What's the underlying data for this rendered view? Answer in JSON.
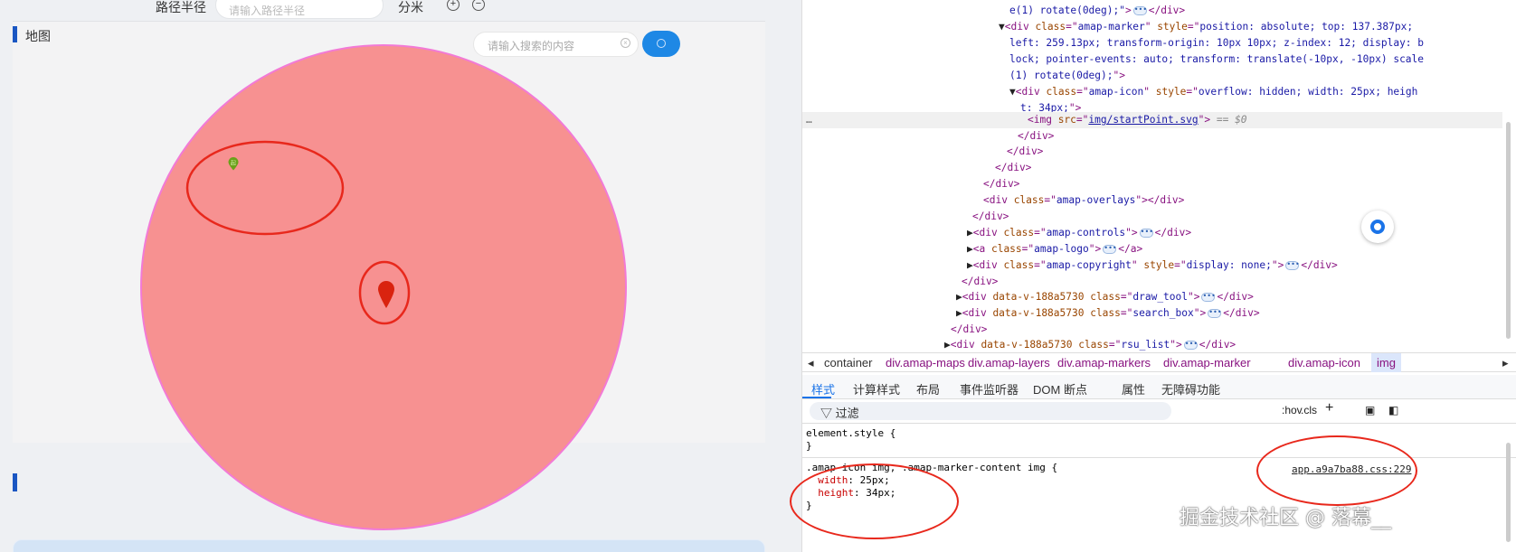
{
  "left": {
    "radius_label": "路径半径",
    "radius_placeholder": "请输入路径半径",
    "unit": "分米",
    "zoom_in": "+",
    "zoom_out": "−",
    "panel_title": "地图",
    "search_placeholder": "请输入搜索的内容",
    "start_marker_label": "起",
    "colors": {
      "circle_fill": "#f79191",
      "circle_stroke": "#f27ad6",
      "annotation": "#e8281c",
      "accent": "#1e88e5"
    }
  },
  "devtools": {
    "dom_lines": [
      [
        [
          "v",
          "e(1) rotate(0deg);\""
        ],
        [
          "t",
          ">"
        ],
        [
          "d",
          ""
        ],
        [
          "t",
          "</div>"
        ]
      ],
      [
        [
          "p",
          "▼"
        ],
        [
          "t",
          "<div "
        ],
        [
          "a",
          "class"
        ],
        [
          "t",
          "=\""
        ],
        [
          "v",
          "amap-marker"
        ],
        [
          "t",
          "\" "
        ],
        [
          "a",
          "style"
        ],
        [
          "t",
          "=\""
        ],
        [
          "v",
          "position: absolute; top: 137.387px;"
        ]
      ],
      [
        [
          "v",
          "left: 259.13px; transform-origin: 10px 10px; z-index: 12; display: b"
        ]
      ],
      [
        [
          "v",
          "lock; pointer-events: auto; transform: translate(-10px, -10px) scale"
        ]
      ],
      [
        [
          "v",
          "(1) rotate(0deg);"
        ],
        [
          "t",
          "\">"
        ]
      ],
      [
        [
          "p",
          "▼"
        ],
        [
          "t",
          "<div "
        ],
        [
          "a",
          "class"
        ],
        [
          "t",
          "=\""
        ],
        [
          "v",
          "amap-icon"
        ],
        [
          "t",
          "\" "
        ],
        [
          "a",
          "style"
        ],
        [
          "t",
          "=\""
        ],
        [
          "v",
          "overflow: hidden; width: 25px; heigh"
        ]
      ],
      [
        [
          "v",
          "t: 34px;"
        ],
        [
          "t",
          "\">"
        ]
      ],
      [
        [
          "t",
          "<img "
        ],
        [
          "a",
          "src"
        ],
        [
          "t",
          "=\""
        ],
        [
          "u",
          "img/startPoint.svg"
        ],
        [
          "t",
          "\">"
        ],
        [
          "g",
          " == $0"
        ]
      ],
      [
        [
          "t",
          "</div>"
        ]
      ],
      [
        [
          "t",
          "</div>"
        ]
      ],
      [
        [
          "t",
          "</div>"
        ]
      ],
      [
        [
          "t",
          "</div>"
        ]
      ],
      [
        [
          "t",
          "<div "
        ],
        [
          "a",
          "class"
        ],
        [
          "t",
          "=\""
        ],
        [
          "v",
          "amap-overlays"
        ],
        [
          "t",
          "\"></div>"
        ]
      ],
      [
        [
          "t",
          "</div>"
        ]
      ],
      [
        [
          "p",
          "▶"
        ],
        [
          "t",
          "<div "
        ],
        [
          "a",
          "class"
        ],
        [
          "t",
          "=\""
        ],
        [
          "v",
          "amap-controls"
        ],
        [
          "t",
          "\">"
        ],
        [
          "d",
          ""
        ],
        [
          "t",
          "</div>"
        ]
      ],
      [
        [
          "p",
          "▶"
        ],
        [
          "t",
          "<a "
        ],
        [
          "a",
          "class"
        ],
        [
          "t",
          "=\""
        ],
        [
          "v",
          "amap-logo"
        ],
        [
          "t",
          "\">"
        ],
        [
          "d",
          ""
        ],
        [
          "t",
          "</a>"
        ]
      ],
      [
        [
          "p",
          "▶"
        ],
        [
          "t",
          "<div "
        ],
        [
          "a",
          "class"
        ],
        [
          "t",
          "=\""
        ],
        [
          "v",
          "amap-copyright"
        ],
        [
          "t",
          "\" "
        ],
        [
          "a",
          "style"
        ],
        [
          "t",
          "=\""
        ],
        [
          "v",
          "display: none;"
        ],
        [
          "t",
          "\">"
        ],
        [
          "d",
          ""
        ],
        [
          "t",
          "</div>"
        ]
      ],
      [
        [
          "t",
          "</div>"
        ]
      ],
      [
        [
          "p",
          "▶"
        ],
        [
          "t",
          "<div "
        ],
        [
          "a",
          "data-v-188a5730 class"
        ],
        [
          "t",
          "=\""
        ],
        [
          "v",
          "draw_tool"
        ],
        [
          "t",
          "\">"
        ],
        [
          "d",
          ""
        ],
        [
          "t",
          "</div>"
        ]
      ],
      [
        [
          "p",
          "▶"
        ],
        [
          "t",
          "<div "
        ],
        [
          "a",
          "data-v-188a5730 class"
        ],
        [
          "t",
          "=\""
        ],
        [
          "v",
          "search_box"
        ],
        [
          "t",
          "\">"
        ],
        [
          "d",
          ""
        ],
        [
          "t",
          "</div>"
        ]
      ],
      [
        [
          "t",
          "</div>"
        ]
      ],
      [
        [
          "p",
          "▶"
        ],
        [
          "t",
          "<div "
        ],
        [
          "a",
          "data-v-188a5730 class"
        ],
        [
          "t",
          "=\""
        ],
        [
          "v",
          "rsu_list"
        ],
        [
          "t",
          "\">"
        ],
        [
          "d",
          ""
        ],
        [
          "t",
          "</div>"
        ]
      ]
    ],
    "breadcrumbs": [
      "container",
      "div.amap-maps",
      "div.amap-layers",
      "div.amap-markers",
      "div.amap-marker",
      "div.amap-icon",
      "img"
    ],
    "tabs": [
      "样式",
      "计算样式",
      "布局",
      "事件监听器",
      "DOM 断点",
      "属性",
      "无障碍功能"
    ],
    "filter_label": "过滤",
    "tools": [
      ":hov",
      ".cls",
      "+"
    ],
    "styles": {
      "element_style": "element.style {",
      "close": "}",
      "selector": ".amap-icon img, .amap-marker-content img {",
      "prop1_name": "width",
      "prop1_value": "25px;",
      "prop2_name": "height",
      "prop2_value": "34px;",
      "source": "app.a9a7ba88.css:229"
    },
    "watermark": "掘金技术社区 @ 落幕__"
  }
}
